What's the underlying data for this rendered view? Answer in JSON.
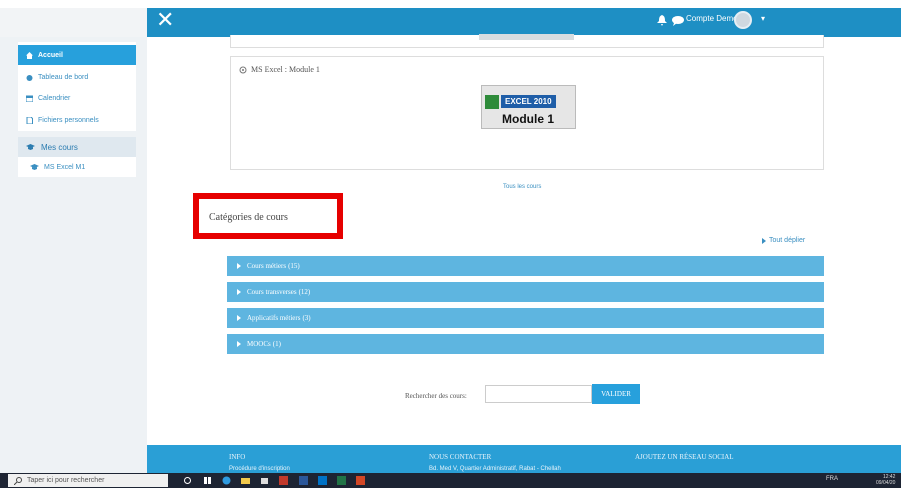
{
  "topbar": {
    "close_icon": "close-icon",
    "user_name": "Compte Demo",
    "accent": "#1e8fc4"
  },
  "sidebar": {
    "items": [
      {
        "label": "Accueil",
        "icon": "home-icon",
        "active": true
      },
      {
        "label": "Tableau de bord",
        "icon": "dashboard-icon"
      },
      {
        "label": "Calendrier",
        "icon": "calendar-icon"
      },
      {
        "label": "Fichiers personnels",
        "icon": "file-icon"
      }
    ],
    "my_courses": {
      "label": "Mes cours",
      "icon": "graduation-cap-icon",
      "items": [
        {
          "label": "MS Excel M1",
          "icon": "graduation-cap-icon"
        }
      ]
    }
  },
  "main": {
    "course_card": {
      "title": "MS Excel : Module 1",
      "image": {
        "badge": "EXCEL 2010",
        "text": "Module 1"
      }
    },
    "all_courses_link": "Tous les cours",
    "categories_title": "Catégories de cours",
    "expand_all": "Tout déplier",
    "categories": [
      {
        "label": "Cours métiers",
        "count": "(15)"
      },
      {
        "label": "Cours transverses",
        "count": "(12)"
      },
      {
        "label": "Applicatifs métiers",
        "count": "(3)"
      },
      {
        "label": "MOOCs",
        "count": "(1)"
      }
    ],
    "search": {
      "label": "Rechercher des cours:",
      "value": "",
      "button": "VALIDER"
    },
    "highlight_color": "#e60000"
  },
  "footer": {
    "col1": {
      "title": "INFO",
      "text": "Procédure d'inscription"
    },
    "col2": {
      "title": "NOUS CONTACTER",
      "text": "Bd. Med V, Quartier Administratif, Rabat - Chellah"
    },
    "col3": {
      "title": "AJOUTEZ UN RÉSEAU SOCIAL"
    }
  },
  "taskbar": {
    "search_placeholder": "Taper ici pour rechercher",
    "lang": "FRA",
    "time": "12:42",
    "date": "09/04/20"
  }
}
